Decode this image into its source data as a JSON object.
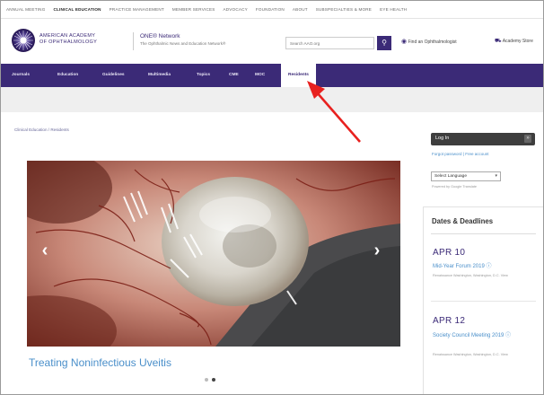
{
  "utility_nav": {
    "items": [
      "Annual Meeting",
      "Clinical Education",
      "Practice Management",
      "Member Services",
      "Advocacy",
      "Foundation",
      "About",
      "Subspecialties & More",
      "Eye Health"
    ],
    "active_index": 1
  },
  "header": {
    "logo_line1": "American Academy",
    "logo_line2": "of Ophthalmology",
    "network_title": "ONE® Network",
    "network_subtitle": "The Ophthalmic News and Education Network®",
    "search_placeholder": "Search AAO.org",
    "find_ophthalmologist": "Find an Ophthalmologist",
    "academy_store": "Academy Store"
  },
  "nav": {
    "items": [
      "Journals",
      "Education",
      "Guidelines",
      "Multimedia",
      "Topics",
      "CME",
      "MOC",
      "Residents"
    ],
    "active_label": "Residents"
  },
  "breadcrumb": "Clinical Education / Residents",
  "carousel": {
    "caption": "Treating Noninfectious Uveitis",
    "prev_glyph": "‹",
    "next_glyph": "›",
    "slides": 2,
    "active_slide": 1
  },
  "sidebar": {
    "login_label": "Log In",
    "login_toggle_glyph": "»",
    "forgot_password": "Forgot password",
    "create_account": "Free account",
    "language_select": "Select Language",
    "powered_by": "Powered by Google Translate"
  },
  "dates": {
    "title": "Dates & Deadlines",
    "events": [
      {
        "date": "APR 10",
        "title": "Mid-Year Forum 2019 ⓘ",
        "meta": "Renaissance Washington, Washington, D.C. View"
      },
      {
        "date": "APR 12",
        "title": "Society Council Meeting 2019 ⓘ",
        "meta": "Renaissance Washington, Washington, D.C. View"
      }
    ]
  },
  "colors": {
    "brand_purple": "#3b2a77",
    "link_blue": "#4a8fca",
    "annotation_red": "#e8211f"
  }
}
